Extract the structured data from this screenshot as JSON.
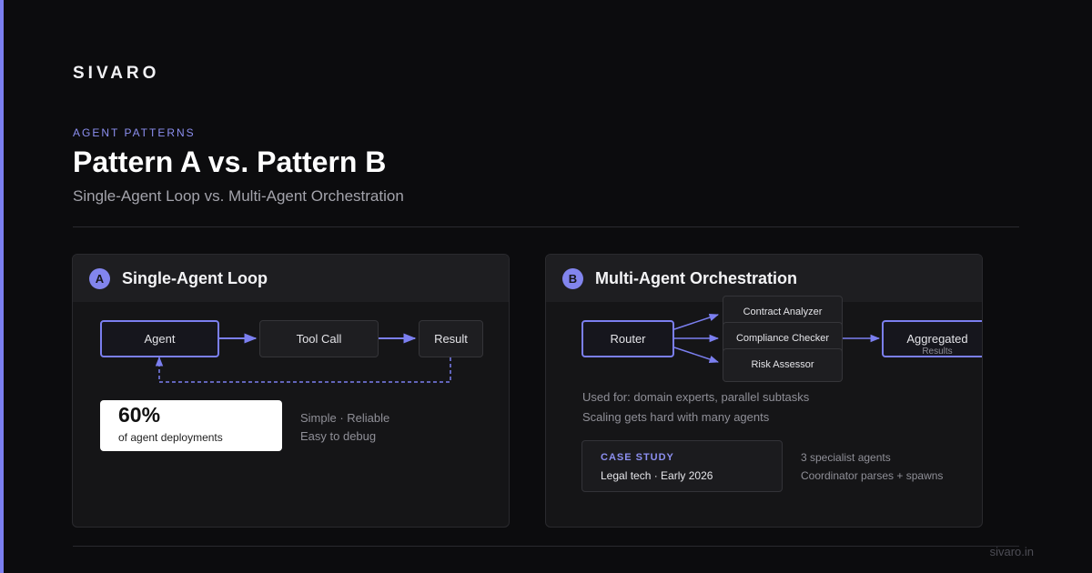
{
  "brand": "SIVARO",
  "eyebrow": "AGENT PATTERNS",
  "title": "Pattern A vs. Pattern B",
  "subtitle": "Single-Agent Loop vs. Multi-Agent Orchestration",
  "footer": "sivaro.in",
  "colors": {
    "accent": "#7b7ff0",
    "background": "#0c0c0e",
    "card": "#151517"
  },
  "pattern_a": {
    "badge": "A",
    "title": "Single-Agent Loop",
    "nodes": {
      "agent": "Agent",
      "tool_call": "Tool Call",
      "result": "Result"
    },
    "stat": {
      "value": "60%",
      "label": "of agent deployments"
    },
    "notes": [
      "Simple · Reliable",
      "Easy to debug"
    ]
  },
  "pattern_b": {
    "badge": "B",
    "title": "Multi-Agent Orchestration",
    "nodes": {
      "router": "Router",
      "specialists": [
        "Contract Analyzer",
        "Compliance Checker",
        "Risk Assessor"
      ],
      "aggregated": "Aggregated",
      "aggregated_sub": "Results"
    },
    "uses": [
      "Used for: domain experts, parallel subtasks",
      "Scaling gets hard with many agents"
    ],
    "case_study": {
      "label": "CASE STUDY",
      "text": "Legal tech · Early 2026"
    },
    "case_notes": [
      "3 specialist agents",
      "Coordinator parses + spawns"
    ]
  }
}
